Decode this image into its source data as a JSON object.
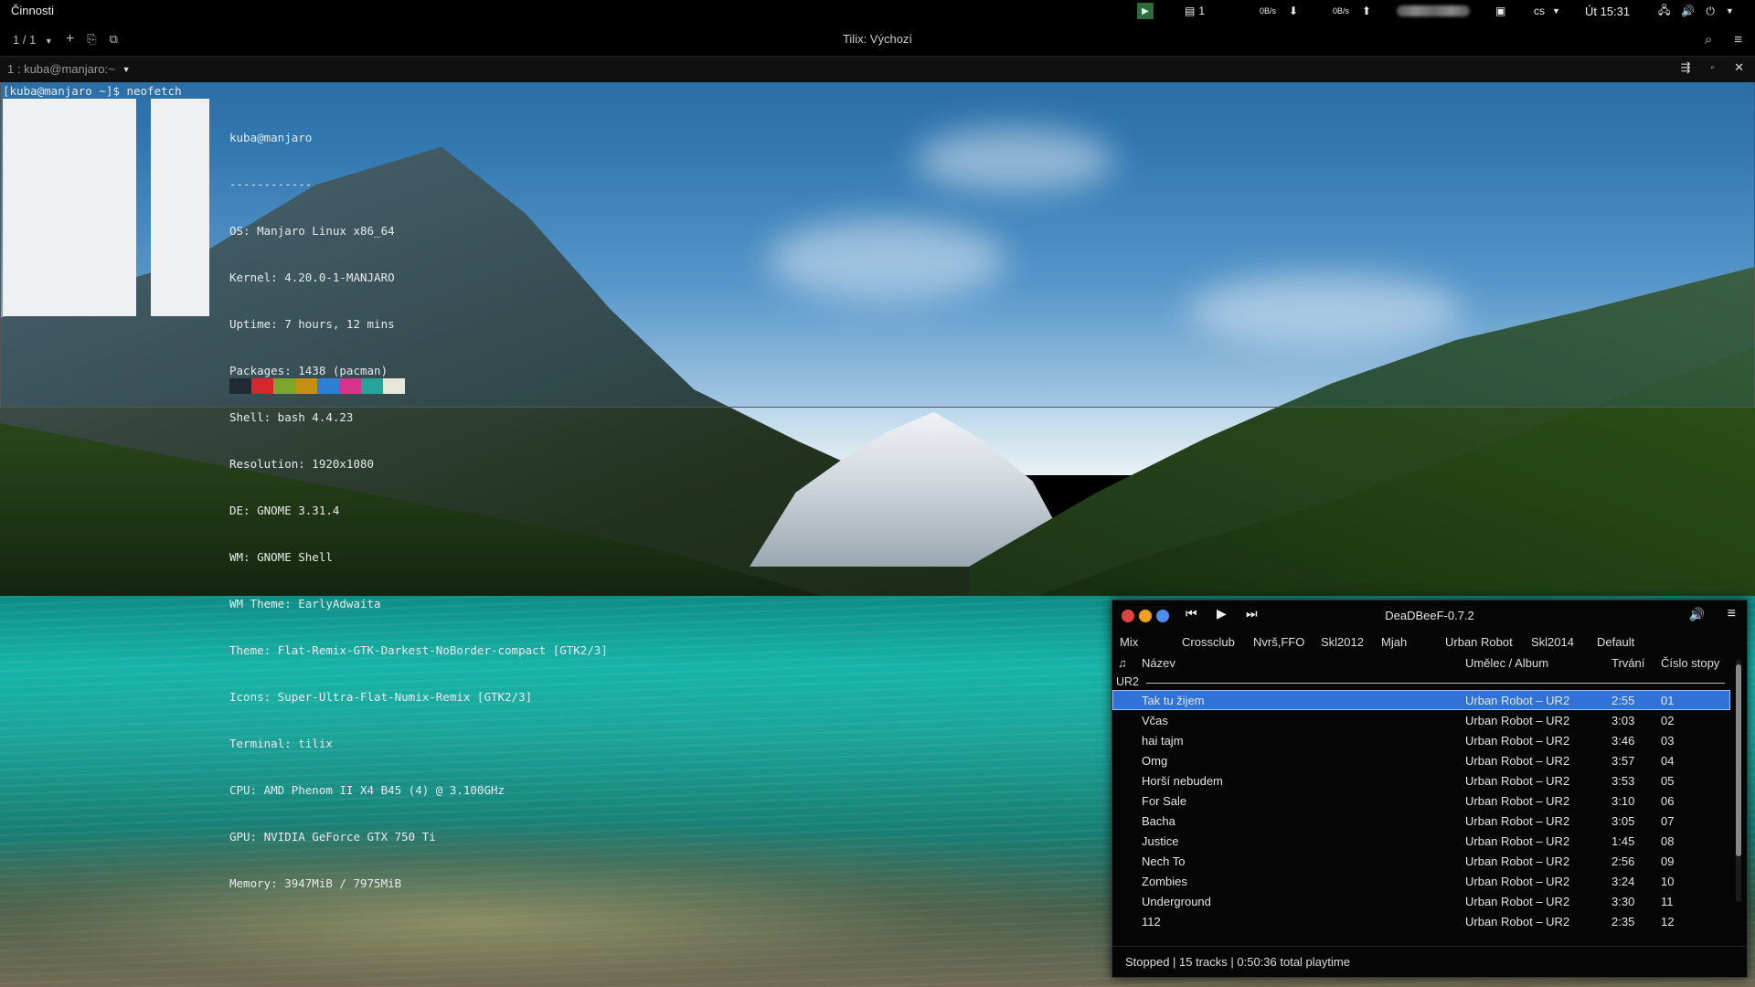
{
  "topbar": {
    "activities": "Činnosti",
    "workspace_count": "1",
    "net_down": "0B/s",
    "net_up": "0B/s",
    "keyboard_layout": "cs",
    "clock": "Út 15:31"
  },
  "tilix": {
    "session_counter": "1 / 1",
    "window_title": "Tilix: Výchozí",
    "terminal_title": "1 : kuba@manjaro:~"
  },
  "terminal": {
    "prompt": "[kuba@manjaro ~]$ neofetch",
    "info": [
      "kuba@manjaro",
      "------------",
      "OS: Manjaro Linux x86_64",
      "Kernel: 4.20.0-1-MANJARO",
      "Uptime: 7 hours, 12 mins",
      "Packages: 1438 (pacman)",
      "Shell: bash 4.4.23",
      "Resolution: 1920x1080",
      "DE: GNOME 3.31.4",
      "WM: GNOME Shell",
      "WM Theme: EarlyAdwaita",
      "Theme: Flat-Remix-GTK-Darkest-NoBorder-compact [GTK2/3]",
      "Icons: Super-Ultra-Flat-Numix-Remix [GTK2/3]",
      "Terminal: tilix",
      "CPU: AMD Phenom II X4 B45 (4) @ 3.100GHz",
      "GPU: NVIDIA GeForce GTX 750 Ti",
      "Memory: 3947MiB / 7975MiB"
    ],
    "palette": [
      "#1f2a33",
      "#d8262e",
      "#7ba62b",
      "#c58f10",
      "#2e7fd6",
      "#d6338b",
      "#27a39a",
      "#e8e6d9"
    ]
  },
  "player": {
    "title": "DeaDBeeF-0.7.2",
    "dot_colors": [
      "#e0443e",
      "#f0a020",
      "#4a8ff0"
    ],
    "tabs": [
      "Mix",
      "Crossclub",
      "Nvrš,FFO",
      "Skl2012",
      "Mjah",
      "Urban Robot",
      "Skl2014",
      "Default"
    ],
    "columns": {
      "playing": "♫",
      "title": "Název",
      "artist_album": "Umělec / Album",
      "duration": "Trvání",
      "track_number": "Číslo stopy"
    },
    "group": "UR2",
    "tracks": [
      {
        "title": "Tak tu žijem",
        "artist": "Urban Robot – UR2",
        "duration": "2:55",
        "number": "01"
      },
      {
        "title": "Včas",
        "artist": "Urban Robot – UR2",
        "duration": "3:03",
        "number": "02"
      },
      {
        "title": "hai tajm",
        "artist": "Urban Robot – UR2",
        "duration": "3:46",
        "number": "03"
      },
      {
        "title": "Omg",
        "artist": "Urban Robot – UR2",
        "duration": "3:57",
        "number": "04"
      },
      {
        "title": "Horší nebudem",
        "artist": "Urban Robot – UR2",
        "duration": "3:53",
        "number": "05"
      },
      {
        "title": "For Sale",
        "artist": "Urban Robot – UR2",
        "duration": "3:10",
        "number": "06"
      },
      {
        "title": "Bacha",
        "artist": "Urban Robot – UR2",
        "duration": "3:05",
        "number": "07"
      },
      {
        "title": "Justice",
        "artist": "Urban Robot – UR2",
        "duration": "1:45",
        "number": "08"
      },
      {
        "title": "Nech To",
        "artist": "Urban Robot – UR2",
        "duration": "2:56",
        "number": "09"
      },
      {
        "title": "Zombies",
        "artist": "Urban Robot – UR2",
        "duration": "3:24",
        "number": "10"
      },
      {
        "title": "Underground",
        "artist": "Urban Robot – UR2",
        "duration": "3:30",
        "number": "11"
      },
      {
        "title": "112",
        "artist": "Urban Robot – UR2",
        "duration": "2:35",
        "number": "12"
      }
    ],
    "selected_index": 0,
    "status": "Stopped | 15 tracks | 0:50:36 total playtime"
  }
}
